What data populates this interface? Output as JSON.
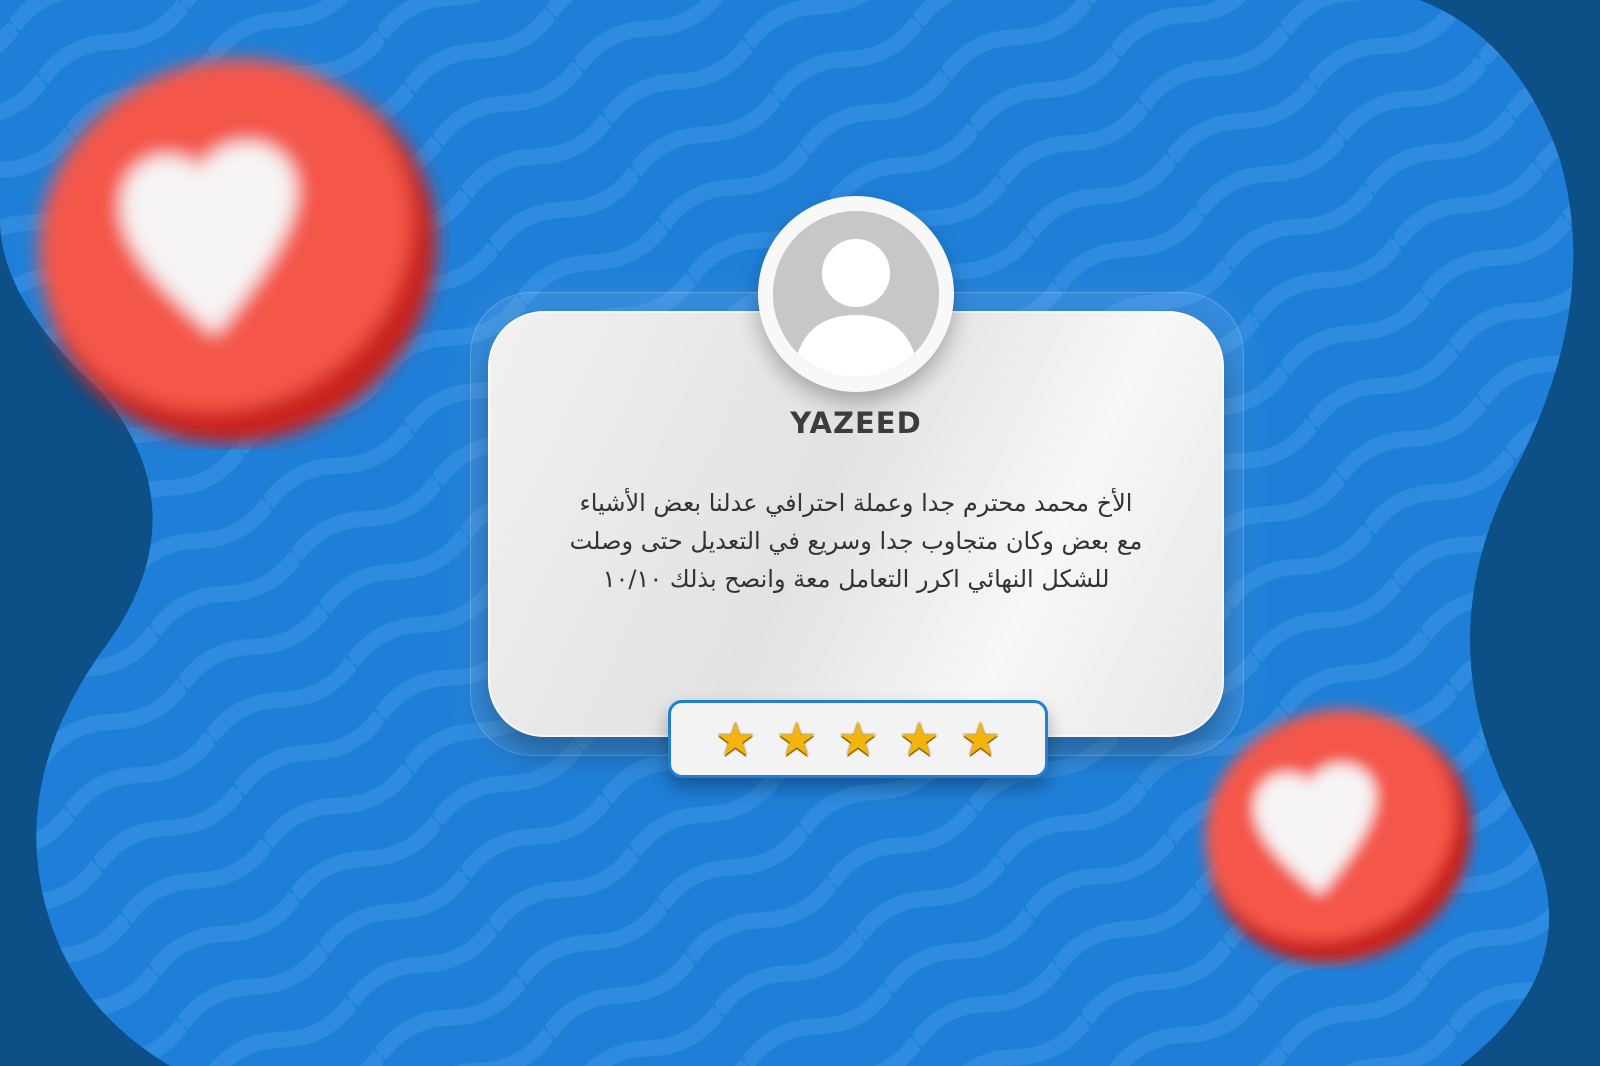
{
  "review": {
    "reviewer_name": "YAZEED",
    "text_lines": [
      "الأخ محمد محترم جدا وعملة احترافي عدلنا بعض الأشياء",
      "مع بعض وكان متجاوب جدا وسريع في التعديل حتى وصلت",
      "للشكل النهائي اكرر التعامل معة وانصح بذلك ١٠/١٠"
    ],
    "rating": {
      "stars": 5,
      "max": 5,
      "star_icon": "star-icon"
    },
    "avatar_icon": "user-silhouette-icon"
  },
  "decorations": {
    "heart_icon": "heart-icon",
    "count": 2
  },
  "colors": {
    "background_blue": "#1f7fd8",
    "background_dark": "#0d4f87",
    "heart_red": "#f0473a",
    "star_gold": "#f2b40f",
    "rating_border": "#1e7fd6"
  }
}
